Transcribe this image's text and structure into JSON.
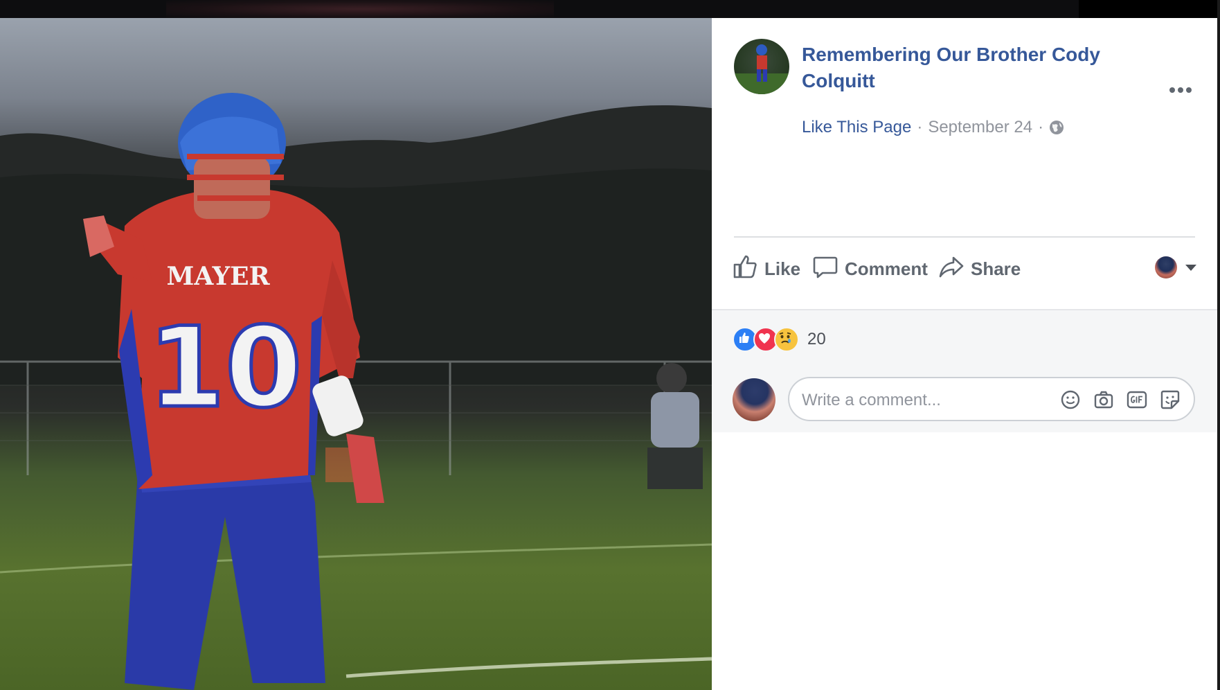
{
  "post": {
    "page_name": "Remembering Our Brother Cody Colquitt",
    "like_page_label": "Like This Page",
    "separator": "·",
    "date": "September 24",
    "privacy_icon": "globe-icon",
    "more_icon": "more-options-icon"
  },
  "photo": {
    "jersey_team": "MAYER",
    "jersey_number": "10"
  },
  "actions": {
    "like_label": "Like",
    "comment_label": "Comment",
    "share_label": "Share"
  },
  "feedback": {
    "reactions": [
      "like",
      "love",
      "sad"
    ],
    "reaction_count": "20"
  },
  "comment": {
    "placeholder": "Write a comment...",
    "icons": [
      "emoji-icon",
      "camera-icon",
      "gif-icon",
      "sticker-icon"
    ]
  },
  "colors": {
    "link": "#365899",
    "meta": "#90949c",
    "action": "#606770",
    "like": "#2c7ff5",
    "love": "#f0344f",
    "sad": "#f7c33e"
  }
}
